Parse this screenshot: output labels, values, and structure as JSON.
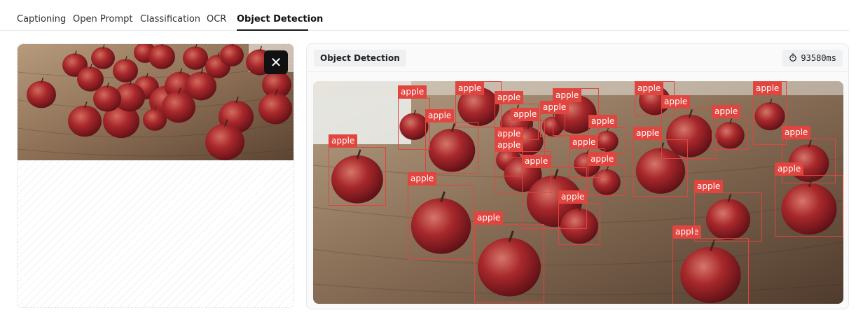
{
  "tabs": [
    {
      "label": "Captioning",
      "active": false
    },
    {
      "label": "Open Prompt",
      "active": false
    },
    {
      "label": "Classification",
      "active": false
    },
    {
      "label": "OCR",
      "active": false
    },
    {
      "label": "Object Detection",
      "active": true
    }
  ],
  "input_image": {
    "subject": "red apples on a wooden table",
    "close_icon": "close-icon"
  },
  "result": {
    "title": "Object Detection",
    "timer_icon": "stopwatch-icon",
    "elapsed": "93580ms",
    "detections": [
      {
        "label": "apple"
      },
      {
        "label": "apple"
      },
      {
        "label": "apple"
      },
      {
        "label": "apple"
      },
      {
        "label": "apple"
      },
      {
        "label": "apple"
      },
      {
        "label": "apple"
      },
      {
        "label": "apple"
      },
      {
        "label": "apple"
      },
      {
        "label": "apple"
      },
      {
        "label": "apple"
      },
      {
        "label": "apple"
      },
      {
        "label": "apple"
      },
      {
        "label": "apple"
      },
      {
        "label": "apple"
      },
      {
        "label": "apple"
      },
      {
        "label": "apple"
      },
      {
        "label": "apple"
      },
      {
        "label": "apple"
      },
      {
        "label": "apple"
      },
      {
        "label": "apple"
      },
      {
        "label": "apple"
      },
      {
        "label": "apple"
      },
      {
        "label": "apple"
      },
      {
        "label": "apple"
      },
      {
        "label": "apple"
      }
    ]
  },
  "colors": {
    "box": "#e0453f",
    "tab_active": "#1a1a1a",
    "close_button": "#111111"
  }
}
